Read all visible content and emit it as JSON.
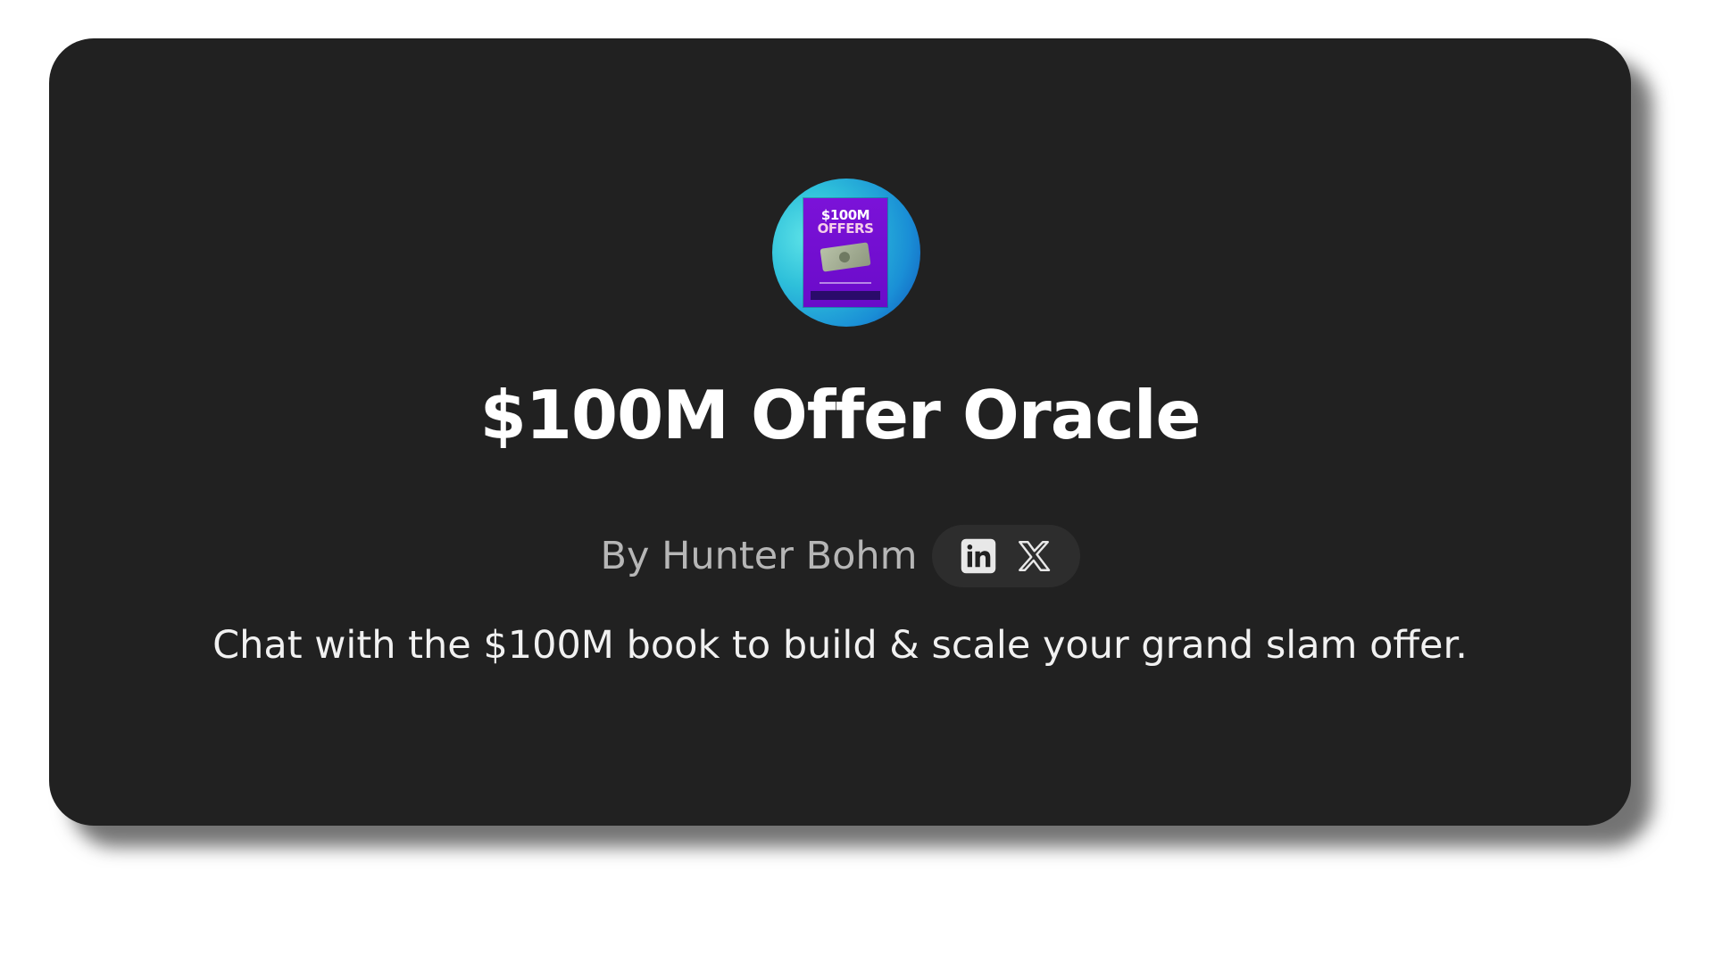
{
  "gpt": {
    "title": "$100M Offer Oracle",
    "author": "By Hunter Bohm",
    "description": "Chat with the $100M book to build & scale your grand slam offer."
  },
  "avatar": {
    "line1": "$100M",
    "line2": "OFFERS"
  },
  "socials": [
    {
      "name": "linkedin-icon"
    },
    {
      "name": "x-icon"
    }
  ],
  "colors": {
    "card_bg": "#212121",
    "title": "#ffffff",
    "byline": "#b6b6b6",
    "pill_bg": "#2d2d2d"
  }
}
